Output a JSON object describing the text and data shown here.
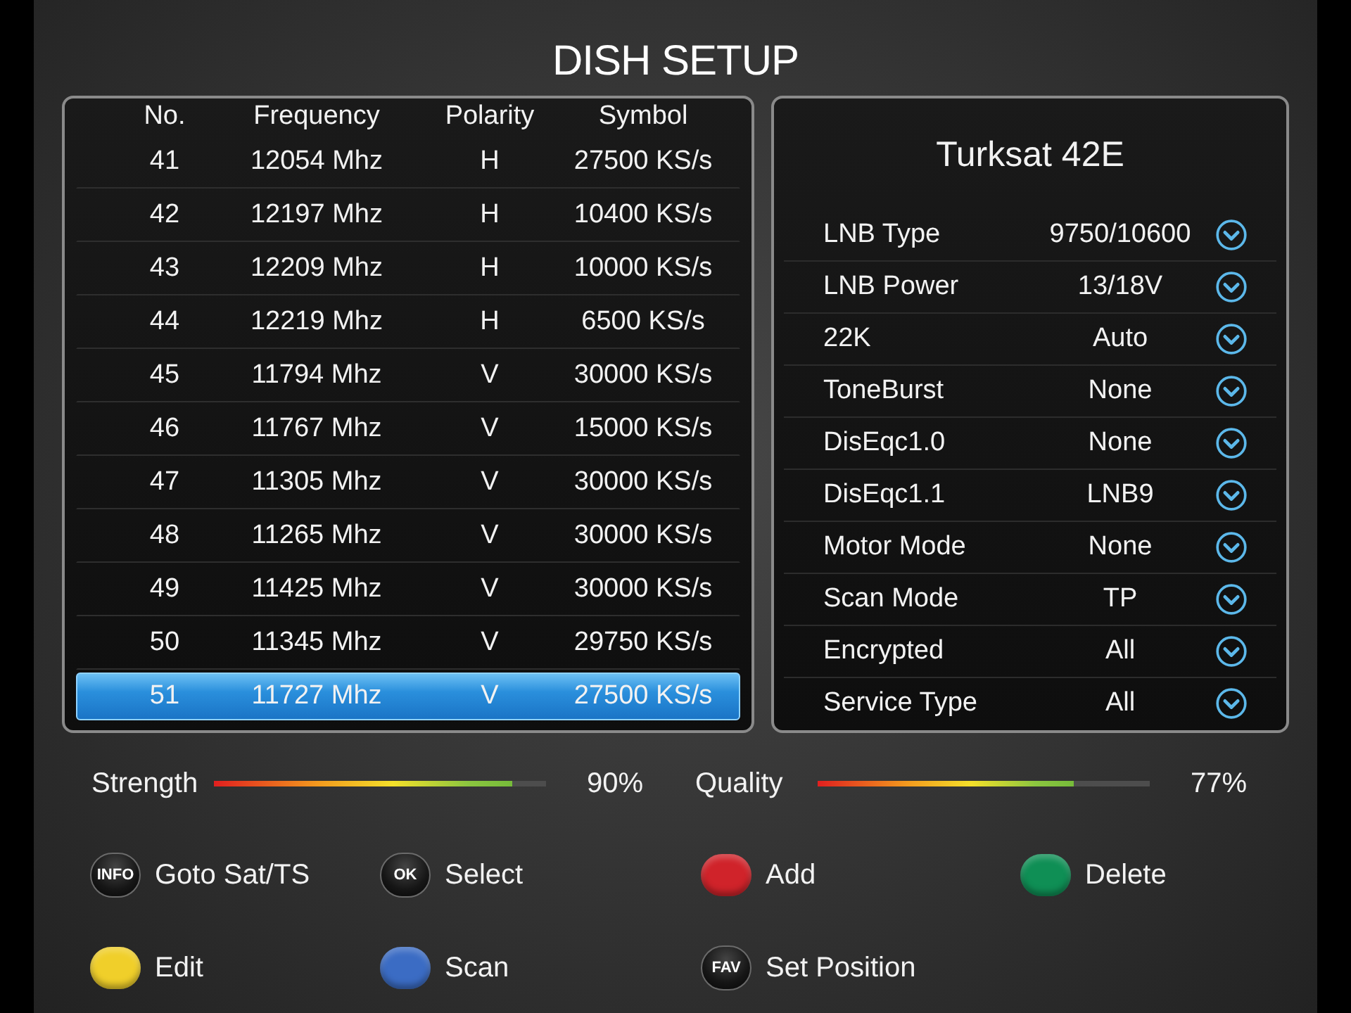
{
  "title": "DISH SETUP",
  "transponder_table": {
    "columns": [
      "No.",
      "Frequency",
      "Polarity",
      "Symbol"
    ],
    "rows": [
      {
        "no": "41",
        "frequency": "12054 Mhz",
        "polarity": "H",
        "symbol": "27500 KS/s",
        "selected": false
      },
      {
        "no": "42",
        "frequency": "12197 Mhz",
        "polarity": "H",
        "symbol": "10400 KS/s",
        "selected": false
      },
      {
        "no": "43",
        "frequency": "12209 Mhz",
        "polarity": "H",
        "symbol": "10000 KS/s",
        "selected": false
      },
      {
        "no": "44",
        "frequency": "12219 Mhz",
        "polarity": "H",
        "symbol": "6500 KS/s",
        "selected": false
      },
      {
        "no": "45",
        "frequency": "11794 Mhz",
        "polarity": "V",
        "symbol": "30000 KS/s",
        "selected": false
      },
      {
        "no": "46",
        "frequency": "11767 Mhz",
        "polarity": "V",
        "symbol": "15000 KS/s",
        "selected": false
      },
      {
        "no": "47",
        "frequency": "11305 Mhz",
        "polarity": "V",
        "symbol": "30000 KS/s",
        "selected": false
      },
      {
        "no": "48",
        "frequency": "11265 Mhz",
        "polarity": "V",
        "symbol": "30000 KS/s",
        "selected": false
      },
      {
        "no": "49",
        "frequency": "11425 Mhz",
        "polarity": "V",
        "symbol": "30000 KS/s",
        "selected": false
      },
      {
        "no": "50",
        "frequency": "11345 Mhz",
        "polarity": "V",
        "symbol": "29750 KS/s",
        "selected": false
      },
      {
        "no": "51",
        "frequency": "11727 Mhz",
        "polarity": "V",
        "symbol": "27500 KS/s",
        "selected": true
      }
    ]
  },
  "satellite_panel": {
    "title": "Turksat 42E",
    "settings": [
      {
        "label": "LNB Type",
        "value": "9750/10600"
      },
      {
        "label": "LNB Power",
        "value": "13/18V"
      },
      {
        "label": "22K",
        "value": "Auto"
      },
      {
        "label": "ToneBurst",
        "value": "None"
      },
      {
        "label": "DisEqc1.0",
        "value": "None"
      },
      {
        "label": "DisEqc1.1",
        "value": "LNB9"
      },
      {
        "label": "Motor Mode",
        "value": "None"
      },
      {
        "label": "Scan Mode",
        "value": "TP"
      },
      {
        "label": "Encrypted",
        "value": "All"
      },
      {
        "label": "Service Type",
        "value": "All"
      }
    ]
  },
  "meters": [
    {
      "label": "Strength",
      "level": 0.9,
      "reading": "90%"
    },
    {
      "label": "Quality",
      "level": 0.77,
      "reading": "77%"
    }
  ],
  "key_legend": [
    {
      "kind": "key",
      "key": "INFO",
      "label": "Goto Sat/TS"
    },
    {
      "kind": "key",
      "key": "OK",
      "label": "Select"
    },
    {
      "kind": "color",
      "color": "#d0232a",
      "label": "Add"
    },
    {
      "kind": "color",
      "color": "#0f8f55",
      "label": "Delete"
    },
    {
      "kind": "color",
      "color": "#f0cf2a",
      "label": "Edit"
    },
    {
      "kind": "color",
      "color": "#3b6cc4",
      "label": "Scan"
    },
    {
      "kind": "key",
      "key": "FAV",
      "label": "Set Position"
    }
  ]
}
